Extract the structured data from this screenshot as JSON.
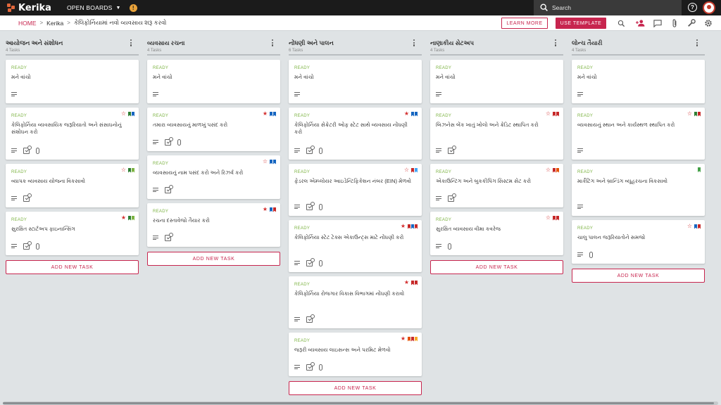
{
  "app": {
    "logo": "Kerika",
    "boards_menu": "OPEN BOARDS",
    "notification_badge": "!",
    "search_placeholder": "Search",
    "help_glyph": "?",
    "accent_color": "#c7254e"
  },
  "breadcrumb": {
    "home": "HOME",
    "board": "Kerika",
    "current": "કેલિફોર્નિયામાં નવો વ્યવસાય શરૂ કરવો"
  },
  "toolbar": {
    "learn_more": "LEARN MORE",
    "use_template": "USE TEMPLATE",
    "icons": [
      "search-icon",
      "add-user-icon",
      "chat-icon",
      "attachment-icon",
      "tools-icon",
      "settings-icon"
    ]
  },
  "add_task_label": "ADD NEW TASK",
  "columns": [
    {
      "title": "આયોજન અને સંશોધન",
      "count": "4 Tasks",
      "cards": [
        {
          "status": "READY",
          "title": "મને વાંચો",
          "star": null,
          "flags": [],
          "desc": true,
          "check": false,
          "clip": false
        },
        {
          "status": "READY",
          "title": "કેલિફોર્નિયા વ્યવસાયિક જરૂરિયાતો અને સંસાધનોનું સંશોધન કરો",
          "star": "outline",
          "flags": [
            "#2e7d32",
            "#1565c0"
          ],
          "desc": true,
          "check": true,
          "clip": true
        },
        {
          "status": "READY",
          "title": "વ્યાપક વ્યવસાય યોજના વિકસાવો",
          "star": "outline",
          "flags": [
            "#2e7d32",
            "#7cb342"
          ],
          "desc": true,
          "check": true,
          "clip": false
        },
        {
          "status": "READY",
          "title": "સુરક્ષિત સ્ટાર્ટઅપ ફાઇનાન્સિંગ",
          "star": "filled",
          "flags": [
            "#2e7d32",
            "#7cb342"
          ],
          "desc": true,
          "check": true,
          "clip": true
        }
      ]
    },
    {
      "title": "વ્યવસાય રચના",
      "count": "4 Tasks",
      "cards": [
        {
          "status": "READY",
          "title": "મને વાંચો",
          "star": null,
          "flags": [],
          "desc": true,
          "check": false,
          "clip": false
        },
        {
          "status": "READY",
          "title": "તમારા વ્યવસાયનું માળખું પસંદ કરો",
          "star": "filled",
          "flags": [
            "#1565c0",
            "#1565c0"
          ],
          "desc": true,
          "check": true,
          "clip": true
        },
        {
          "status": "READY",
          "title": "વ્યવસાયનું નામ પસંદ કરો અને રિઝર્વ કરો",
          "star": "outline",
          "flags": [
            "#1565c0",
            "#1565c0"
          ],
          "desc": true,
          "check": true,
          "clip": false
        },
        {
          "status": "READY",
          "title": "રચના દસ્તાવેજો તૈયાર કરો",
          "star": "filled",
          "flags": [
            "#1565c0",
            "#c62828"
          ],
          "desc": true,
          "check": true,
          "clip": false
        }
      ]
    },
    {
      "title": "નોંધણી અને પાલન",
      "count": "6 Tasks",
      "cards": [
        {
          "status": "READY",
          "title": "મને વાંચો",
          "star": null,
          "flags": [],
          "desc": true,
          "check": false,
          "clip": false
        },
        {
          "status": "READY",
          "title": "કેલિફોર્નિયા સેક્રેટરી ઓફ સ્ટેટ સાથે વ્યવસાય નોંધણી કરો",
          "star": "filled",
          "flags": [
            "#1565c0",
            "#1565c0"
          ],
          "desc": true,
          "check": true,
          "clip": true
        },
        {
          "status": "READY",
          "title": "ફેડરલ એમ્પ્લોયર આઇડેન્ટિફિકેશન નંબર (EIN) મેળવો",
          "star": "outline",
          "flags": [
            "#c62828",
            "#42a5f5"
          ],
          "desc": true,
          "check": true,
          "clip": true
        },
        {
          "status": "READY",
          "title": "કેલિફોર્નિયા સ્ટેટ ટેક્સ એકાઉન્ટ્સ માટે નોંધણી કરો",
          "star": "filled",
          "flags": [
            "#c62828",
            "#1565c0",
            "#c62828"
          ],
          "desc": true,
          "check": true,
          "clip": true
        },
        {
          "status": "READY",
          "title": "કેલિફોર્નિયા રોજગાર વિકાસ વિભાગમાં નોંધણી કરાવો",
          "star": "filled",
          "flags": [
            "#c62828",
            "#c62828"
          ],
          "desc": true,
          "check": true,
          "clip": false
        },
        {
          "status": "READY",
          "title": "જરૂરી વ્યવસાય લાઇસન્સ અને પરમિટ મેળવો",
          "star": "filled",
          "flags": [
            "#e65100",
            "#c62828",
            "#f9a825"
          ],
          "desc": true,
          "check": true,
          "clip": true
        }
      ]
    },
    {
      "title": "નાણાકીય સેટઅપ",
      "count": "4 Tasks",
      "cards": [
        {
          "status": "READY",
          "title": "મને વાંચો",
          "star": null,
          "flags": [],
          "desc": true,
          "check": false,
          "clip": false
        },
        {
          "status": "READY",
          "title": "બિઝનેસ બેંક ખાતું ખોલો અને ક્રેડિટ સ્થાપિત કરો",
          "star": "outline",
          "flags": [
            "#c62828",
            "#c62828"
          ],
          "desc": true,
          "check": true,
          "clip": false
        },
        {
          "status": "READY",
          "title": "એકાઉન્ટિંગ અને બુકકીપિંગ સિસ્ટમ સેટ કરો",
          "star": "outline",
          "flags": [
            "#c62828",
            "#e65100"
          ],
          "desc": true,
          "check": true,
          "clip": false
        },
        {
          "status": "READY",
          "title": "સુરક્ષિત વ્યવસાય વીમા કવરેજ",
          "star": "outline",
          "flags": [
            "#c62828",
            "#c62828"
          ],
          "desc": true,
          "check": false,
          "clip": true
        }
      ]
    },
    {
      "title": "લોન્ચ તૈયારી",
      "count": "4 Tasks",
      "cards": [
        {
          "status": "READY",
          "title": "મને વાંચો",
          "star": null,
          "flags": [],
          "desc": true,
          "check": false,
          "clip": false
        },
        {
          "status": "READY",
          "title": "વ્યવસાયનું સ્થાન અને કાર્યસ્થળ સ્થાપિત કરો",
          "star": "outline",
          "flags": [
            "#2e7d32",
            "#c62828"
          ],
          "desc": true,
          "check": false,
          "clip": false
        },
        {
          "status": "READY",
          "title": "માર્કેટિંગ અને બ્રાન્ડિંગ વ્યૂહરચના વિકસાવો",
          "star": null,
          "flags": [
            "#43a047"
          ],
          "desc": true,
          "check": false,
          "clip": false
        },
        {
          "status": "READY",
          "title": "ચાલુ પાલન જરૂરિયાતોને સમજો",
          "star": "outline",
          "flags": [
            "#1565c0",
            "#c62828"
          ],
          "desc": true,
          "check": false,
          "clip": true
        }
      ]
    }
  ]
}
